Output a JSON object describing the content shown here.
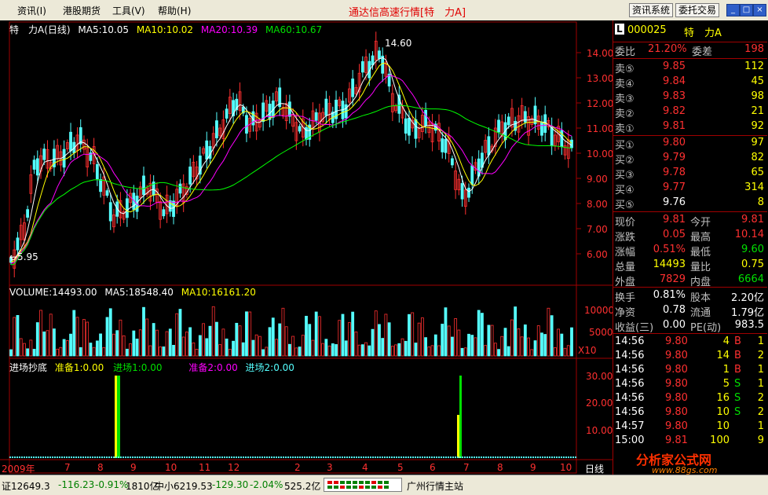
{
  "menu": {
    "items": [
      "资讯(I)",
      "港股期货",
      "工具(V)",
      "帮助(H)"
    ],
    "title": "通达信高速行情[特　力A]",
    "btn_news": "资讯系统",
    "btn_trade": "委托交易"
  },
  "chart_header": {
    "name": "特　力A(日线)",
    "ma5": "MA5:10.05",
    "ma10": "MA10:10.02",
    "ma20": "MA20:10.39",
    "ma60": "MA60:10.67",
    "high_marker": "14.60",
    "low_marker": "←5.95",
    "price_axis": [
      "14.00",
      "13.00",
      "12.00",
      "11.00",
      "10.00",
      "9.00",
      "8.00",
      "7.00",
      "6.00"
    ],
    "colors": {
      "ma5": "#ffffff",
      "ma10": "#ffff00",
      "ma20": "#ff00ff",
      "ma60": "#00ff00",
      "up": "#ff3030",
      "down": "#55ffff"
    }
  },
  "volume_header": {
    "vol": "VOLUME:14493.00",
    "ma5": "MA5:18548.40",
    "ma10": "MA10:16161.20",
    "axis": [
      "10000",
      "5000"
    ],
    "unit": "X10"
  },
  "indicator_header": {
    "name": "进场抄底",
    "a": "准备1:0.00",
    "b": "进场1:0.00",
    "c": "准备2:0.00",
    "d": "进场2:0.00",
    "axis": [
      "30.00",
      "20.00",
      "10.00"
    ]
  },
  "time_axis": {
    "labels": [
      "2009年",
      "7",
      "8",
      "9",
      "10",
      "11",
      "12",
      "2",
      "3",
      "4",
      "5",
      "6",
      "7",
      "8",
      "9",
      "10"
    ],
    "period": "日线"
  },
  "quote": {
    "code": "000025",
    "name": "特　力A",
    "weibi_label": "委比",
    "weibi": "21.20%",
    "weicha_label": "委差",
    "weicha": "198",
    "asks": [
      {
        "label": "卖⑤",
        "price": "9.85",
        "vol": "112"
      },
      {
        "label": "卖④",
        "price": "9.84",
        "vol": "45"
      },
      {
        "label": "卖③",
        "price": "9.83",
        "vol": "98"
      },
      {
        "label": "卖②",
        "price": "9.82",
        "vol": "21"
      },
      {
        "label": "卖①",
        "price": "9.81",
        "vol": "92"
      }
    ],
    "bids": [
      {
        "label": "买①",
        "price": "9.80",
        "vol": "97"
      },
      {
        "label": "买②",
        "price": "9.79",
        "vol": "82"
      },
      {
        "label": "买③",
        "price": "9.78",
        "vol": "65"
      },
      {
        "label": "买④",
        "price": "9.77",
        "vol": "314"
      },
      {
        "label": "买⑤",
        "price": "9.76",
        "vol": "8"
      }
    ],
    "stats": [
      {
        "l1": "现价",
        "v1": "9.81",
        "l2": "今开",
        "v2": "9.81"
      },
      {
        "l1": "涨跌",
        "v1": "0.05",
        "l2": "最高",
        "v2": "10.14"
      },
      {
        "l1": "涨幅",
        "v1": "0.51%",
        "l2": "最低",
        "v2": "9.60"
      },
      {
        "l1": "总量",
        "v1": "14493",
        "l2": "量比",
        "v2": "0.75"
      },
      {
        "l1": "外盘",
        "v1": "7829",
        "l2": "内盘",
        "v2": "6664"
      }
    ],
    "stats2": [
      {
        "l1": "换手",
        "v1": "0.81%",
        "l2": "股本",
        "v2": "2.20亿"
      },
      {
        "l1": "净资",
        "v1": "0.78",
        "l2": "流通",
        "v2": "1.79亿"
      },
      {
        "l1": "收益(三)",
        "v1": "0.00",
        "l2": "PE(动)",
        "v2": "983.5"
      }
    ],
    "ticks": [
      {
        "time": "14:56",
        "price": "9.80",
        "vol": "4",
        "bs": "B",
        "n": "1"
      },
      {
        "time": "14:56",
        "price": "9.80",
        "vol": "14",
        "bs": "B",
        "n": "2"
      },
      {
        "time": "14:56",
        "price": "9.80",
        "vol": "1",
        "bs": "B",
        "n": "1"
      },
      {
        "time": "14:56",
        "price": "9.80",
        "vol": "5",
        "bs": "S",
        "n": "1"
      },
      {
        "time": "14:56",
        "price": "9.80",
        "vol": "16",
        "bs": "S",
        "n": "2"
      },
      {
        "time": "14:56",
        "price": "9.80",
        "vol": "10",
        "bs": "S",
        "n": "2"
      },
      {
        "time": "14:57",
        "price": "9.80",
        "vol": "10",
        "bs": "",
        "n": "1"
      },
      {
        "time": "15:00",
        "price": "9.81",
        "vol": "100",
        "bs": "",
        "n": "9"
      }
    ]
  },
  "status": {
    "sh": "证12649.3",
    "sh_chg": "-116.23",
    "sh_pct": "-0.91%",
    "sh_amt": "1810亿",
    "zx": "中小6219.53",
    "zx_chg": "-129.30",
    "zx_pct": "-2.04%",
    "zx_amt": "525.2亿",
    "server": "广州行情主站"
  },
  "watermark": {
    "text1": "分析家公式网",
    "text2": "www.88gs.com"
  }
}
